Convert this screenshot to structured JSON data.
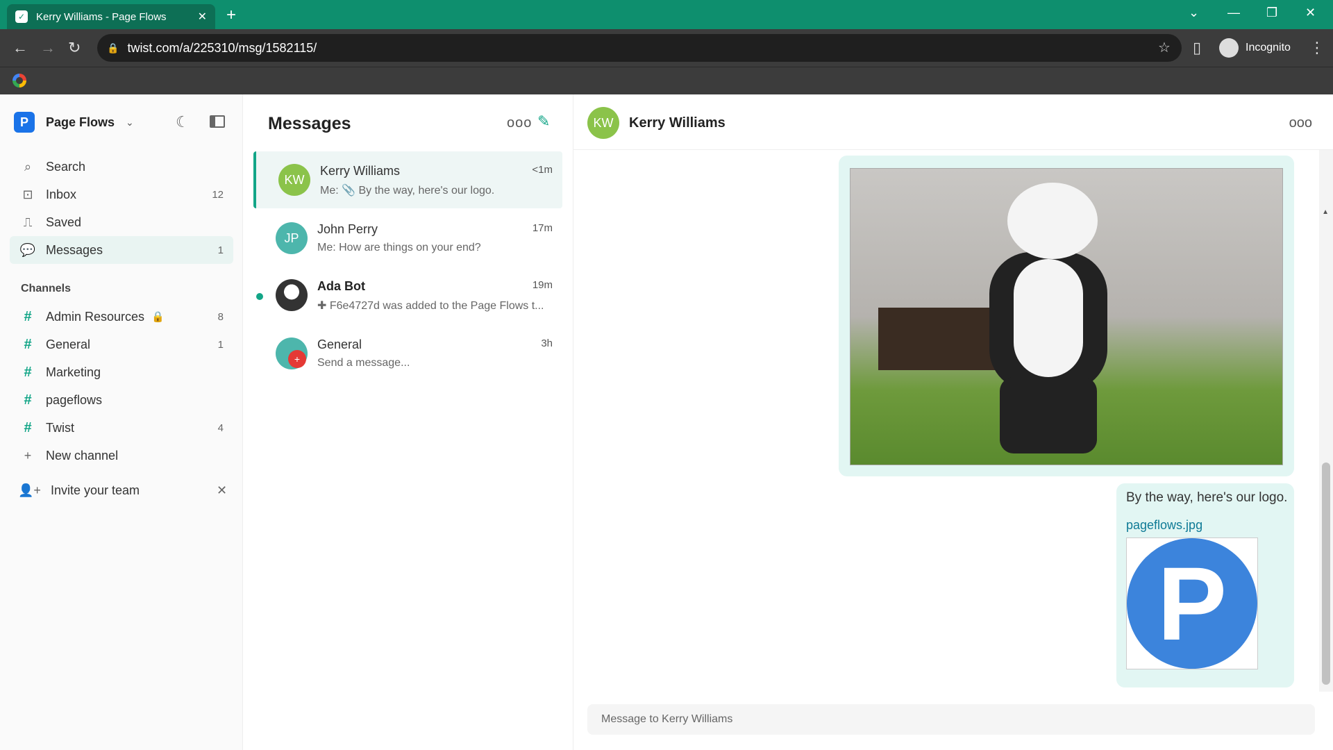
{
  "browser": {
    "tab_title": "Kerry Williams - Page Flows",
    "url": "twist.com/a/225310/msg/1582115/",
    "profile_label": "Incognito"
  },
  "workspace": {
    "name": "Page Flows",
    "logo_letter": "P"
  },
  "sidebar": {
    "nav": [
      {
        "label": "Search",
        "count": ""
      },
      {
        "label": "Inbox",
        "count": "12"
      },
      {
        "label": "Saved",
        "count": ""
      },
      {
        "label": "Messages",
        "count": "1"
      }
    ],
    "channels_heading": "Channels",
    "channels": [
      {
        "label": "Admin Resources",
        "count": "8"
      },
      {
        "label": "General",
        "count": "1"
      },
      {
        "label": "Marketing",
        "count": ""
      },
      {
        "label": "pageflows",
        "count": ""
      },
      {
        "label": "Twist",
        "count": "4"
      }
    ],
    "new_channel": "New channel",
    "invite": "Invite your team"
  },
  "messages_panel": {
    "title": "Messages",
    "conversations": [
      {
        "initials": "KW",
        "name": "Kerry Williams",
        "time": "<1m",
        "preview": "Me: 📎 By the way, here's our logo.",
        "color": "#8bc34a"
      },
      {
        "initials": "JP",
        "name": "John Perry",
        "time": "17m",
        "preview": "Me: How are things on your end?",
        "color": "#4db6ac"
      },
      {
        "initials": "",
        "name": "Ada Bot",
        "time": "19m",
        "preview": "✚ F6e4727d was added to the Page Flows t...",
        "color": "#333333"
      },
      {
        "initials": "",
        "name": "General",
        "time": "3h",
        "preview": "Send a message...",
        "color": "#4db6ac"
      }
    ]
  },
  "thread": {
    "contact_initials": "KW",
    "contact_name": "Kerry Williams",
    "message_text": "By the way, here's our logo.",
    "attachment_name": "pageflows.jpg",
    "logo_letter": "P",
    "composer_placeholder": "Message to Kerry Williams"
  }
}
